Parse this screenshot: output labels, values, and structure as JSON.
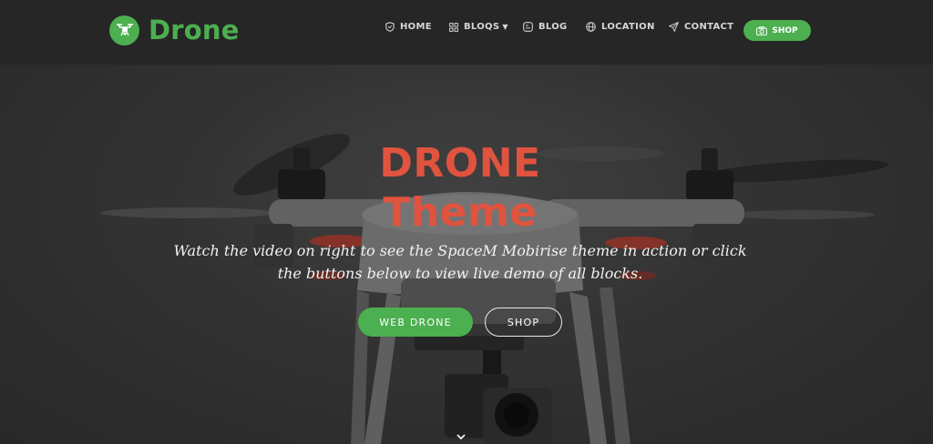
{
  "brand": {
    "name": "Drone",
    "logo_icon": "drone-icon"
  },
  "nav": {
    "items": [
      {
        "label": "HOME",
        "icon": "shield-icon"
      },
      {
        "label": "BLOQS",
        "icon": "grid-icon",
        "has_dropdown": true
      },
      {
        "label": "BLOG",
        "icon": "blog-icon"
      },
      {
        "label": "LOCATION",
        "icon": "globe-icon"
      },
      {
        "label": "CONTACT",
        "icon": "send-icon"
      }
    ],
    "shop_label": "SHOP",
    "shop_icon": "camera-icon"
  },
  "hero": {
    "title_line1": "DRONE",
    "title_line2": "Theme",
    "text": "Watch the video on right to see the SpaceM Mobirise theme in action or click the buttons below to view live demo of all blocks.",
    "primary_button": "WEB DRONE",
    "secondary_button": "SHOP",
    "scroll_icon": "chevron-down-icon"
  },
  "colors": {
    "accent": "#4caf50",
    "title": "#e0533f",
    "navbar_bg": "#262626"
  }
}
